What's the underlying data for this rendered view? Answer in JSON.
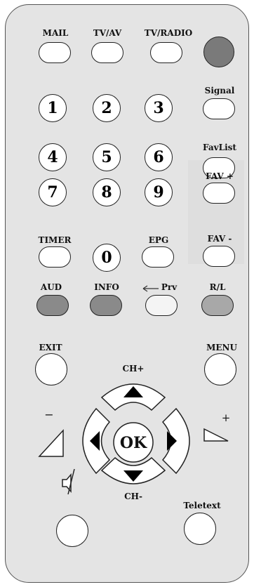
{
  "colors": {
    "body": "#e4e4e4",
    "button": "#ffffff",
    "red_button": "#7a7a7a",
    "aud_button": "#8a8a8a",
    "info_button": "#8a8a8a",
    "prv_button": "#f4f4f4",
    "rl_button": "#a8a8a8",
    "outline": "#222222"
  },
  "top_row": {
    "mail": "MAIL",
    "tv_av": "TV/AV",
    "tv_radio": "TV/RADIO"
  },
  "side": {
    "signal": "Signal",
    "favlist": "FavList",
    "fav_plus": "FAV +",
    "fav_minus": "FAV -"
  },
  "numbers": [
    "1",
    "2",
    "3",
    "4",
    "5",
    "6",
    "7",
    "8",
    "9",
    "0"
  ],
  "timer": "TIMER",
  "epg": "EPG",
  "color_row": {
    "aud": "AUD",
    "info": "INFO",
    "prv": "Prv",
    "rl": "R/L"
  },
  "exit": "EXIT",
  "menu": "MENU",
  "nav": {
    "ch_plus": "CH+",
    "ch_minus": "CH-",
    "ok": "OK",
    "vol_minus": "−",
    "vol_plus": "+"
  },
  "teletext": "Teletext",
  "icons": {
    "mute": "speaker-mute-icon",
    "prv_arrow": "left-arrow-icon",
    "up": "up-triangle-icon",
    "down": "down-triangle-icon",
    "left": "left-triangle-icon",
    "right": "right-triangle-icon"
  }
}
